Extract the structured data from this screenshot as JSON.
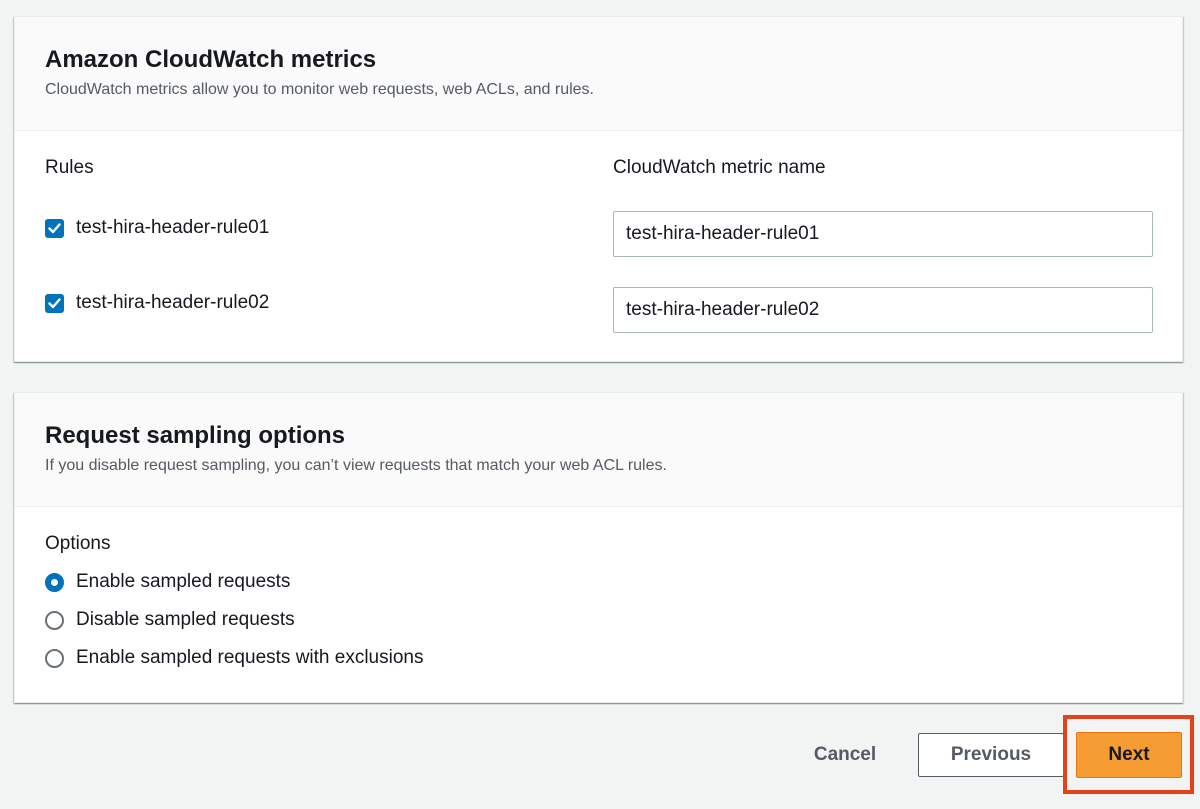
{
  "cloudwatch": {
    "title": "Amazon CloudWatch metrics",
    "description": "CloudWatch metrics allow you to monitor web requests, web ACLs, and rules.",
    "rules_header": "Rules",
    "metric_header": "CloudWatch metric name",
    "rules": [
      {
        "label": "test-hira-header-rule01",
        "checked": true,
        "metric_name": "test-hira-header-rule01"
      },
      {
        "label": "test-hira-header-rule02",
        "checked": true,
        "metric_name": "test-hira-header-rule02"
      }
    ]
  },
  "sampling": {
    "title": "Request sampling options",
    "description": "If you disable request sampling, you can’t view requests that match your web ACL rules.",
    "options_label": "Options",
    "options": [
      {
        "label": "Enable sampled requests",
        "selected": true
      },
      {
        "label": "Disable sampled requests",
        "selected": false
      },
      {
        "label": "Enable sampled requests with exclusions",
        "selected": false
      }
    ]
  },
  "footer": {
    "cancel_label": "Cancel",
    "previous_label": "Previous",
    "next_label": "Next"
  },
  "colors": {
    "accent": "#0073bb",
    "primary_button": "#f59c32",
    "highlight": "#e5411b"
  }
}
